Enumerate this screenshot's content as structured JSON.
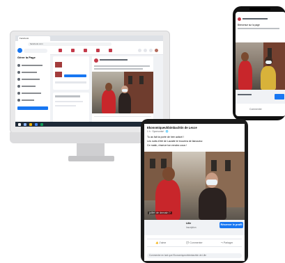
{
  "imac": {
    "tab_title": "Facebook",
    "url": "facebook.com",
    "sidebar_title": "Gérer la Page",
    "nav_items": [
      "",
      "",
      "",
      "",
      "",
      ""
    ]
  },
  "phone": {
    "post_text": "Bienvenue sur la page",
    "cta": "Commenter"
  },
  "tablet": {
    "page_name": "Ekonomiqueuhbimbachtin de Lecce",
    "time": "1 h · Sponsorisé · 🌐",
    "lines": [
      "Tu as fait ta porte de hée acticel !",
      "Les nuits d'été de Lazatie te trouvera de ilanoueur.",
      "Ce matin, réserve ton rendez-vous !"
    ],
    "caption": "juillet de demain ?",
    "link_title": "Lille",
    "link_sub": "Inscription",
    "cta": "Réserver le profil",
    "actions": {
      "like": "J'aime",
      "comment": "Commenter",
      "share": "Partager"
    },
    "comment_placeholder": "Commenter en tant que Ekonomiqueuhbimbachtin de Lille"
  }
}
